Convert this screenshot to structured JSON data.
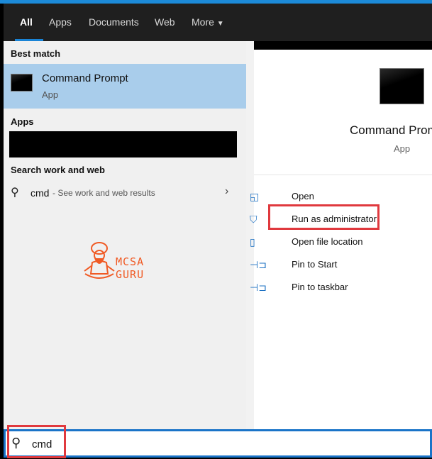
{
  "tabs": [
    {
      "label": "All",
      "active": true
    },
    {
      "label": "Apps"
    },
    {
      "label": "Documents"
    },
    {
      "label": "Web"
    },
    {
      "label": "More"
    }
  ],
  "left": {
    "best_match_heading": "Best match",
    "best_match": {
      "title": "Command Prompt",
      "subtitle": "App"
    },
    "apps_heading": "Apps",
    "search_web_heading": "Search work and web",
    "web_result": {
      "query": "cmd",
      "suffix": " - See work and web results"
    },
    "watermark": "MCSA GURU"
  },
  "right": {
    "title": "Command Prompt",
    "subtitle": "App",
    "actions": [
      {
        "label": "Open",
        "icon": "open-icon"
      },
      {
        "label": "Run as administrator",
        "icon": "shield-icon",
        "highlighted": true
      },
      {
        "label": "Open file location",
        "icon": "file-location-icon"
      },
      {
        "label": "Pin to Start",
        "icon": "pin-icon"
      },
      {
        "label": "Pin to taskbar",
        "icon": "pin-icon"
      }
    ]
  },
  "search": {
    "value": "cmd"
  },
  "colors": {
    "accent": "#1a74c8",
    "highlight": "#a9cdeb",
    "annotation": "#e0393e",
    "watermark": "#f05a24"
  }
}
